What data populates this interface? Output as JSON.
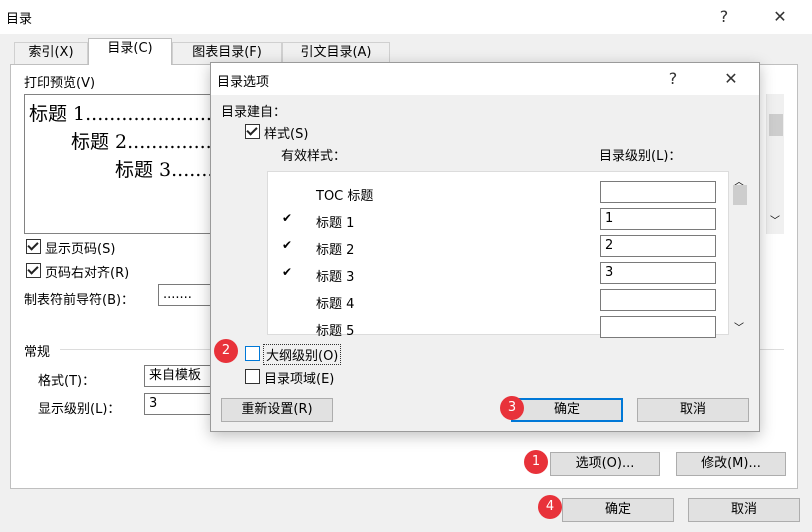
{
  "window": {
    "title": "目录",
    "help_glyph": "?",
    "close_glyph": "✕"
  },
  "tabs": [
    {
      "label": "索引(X)"
    },
    {
      "label": "目录(C)"
    },
    {
      "label": "图表目录(F)"
    },
    {
      "label": "引文目录(A)"
    }
  ],
  "print_preview": {
    "label": "打印预览(V)",
    "lines": [
      "标题 1.....................",
      "标题 2...............",
      "标题 3.........."
    ]
  },
  "options_main": {
    "show_page_numbers": {
      "label": "显示页码(S)",
      "checked": true
    },
    "right_align": {
      "label": "页码右对齐(R)",
      "checked": true
    },
    "tab_leader_label": "制表符前导符(B)：",
    "tab_leader_value": "......."
  },
  "general": {
    "section_label": "常规",
    "format_label": "格式(T)：",
    "format_value": "来自模板",
    "levels_label": "显示级别(L)：",
    "levels_value": "3"
  },
  "main_buttons": {
    "options": "选项(O)...",
    "modify": "修改(M)...",
    "ok": "确定",
    "cancel": "取消"
  },
  "dialog": {
    "title": "目录选项",
    "help_glyph": "?",
    "close_glyph": "✕",
    "build_from": "目录建自：",
    "styles_checkbox": {
      "label": "样式(S)",
      "checked": true
    },
    "available_styles_header": "有效样式：",
    "toc_level_header": "目录级别(L)：",
    "styles": [
      {
        "name": "TOC 标题",
        "checked": false,
        "level": ""
      },
      {
        "name": "标题 1",
        "checked": true,
        "level": "1"
      },
      {
        "name": "标题 2",
        "checked": true,
        "level": "2"
      },
      {
        "name": "标题 3",
        "checked": true,
        "level": "3"
      },
      {
        "name": "标题 4",
        "checked": false,
        "level": ""
      },
      {
        "name": "标题 5",
        "checked": false,
        "level": ""
      }
    ],
    "outline_levels": {
      "label": "大纲级别(O)",
      "checked": false
    },
    "toc_fields": {
      "label": "目录项域(E)",
      "checked": false
    },
    "reset_button": "重新设置(R)",
    "ok_button": "确定",
    "cancel_button": "取消",
    "check_glyph": "✔",
    "scroll_up": "︿",
    "scroll_down": "﹀"
  },
  "badges": [
    "1",
    "2",
    "3",
    "4"
  ],
  "colors": {
    "badge": "#e8323a",
    "focus": "#0078d7"
  }
}
